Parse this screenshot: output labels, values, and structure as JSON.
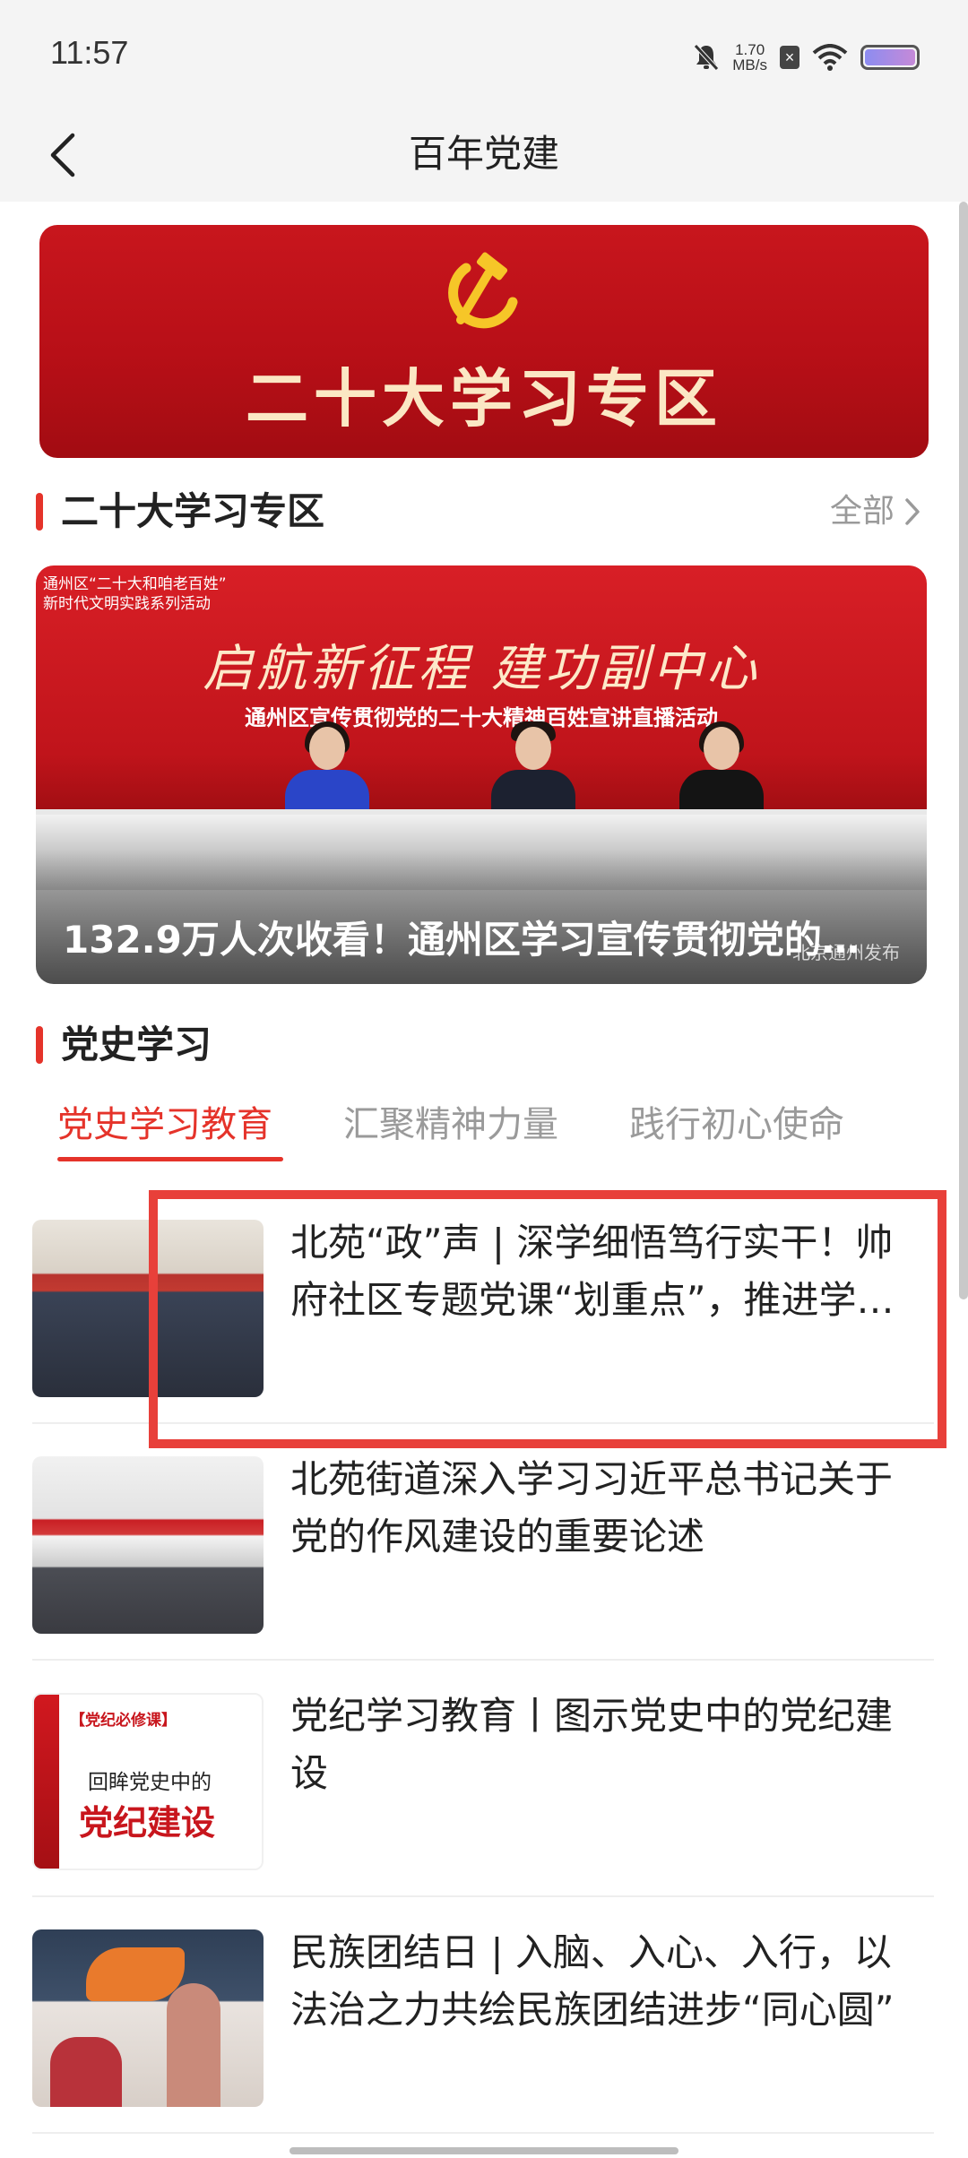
{
  "status_bar": {
    "time": "11:57",
    "net_speed_value": "1.70",
    "net_speed_unit": "MB/s",
    "icons": [
      "mute-icon",
      "close-badge-icon",
      "wifi-icon",
      "battery-icon"
    ]
  },
  "nav": {
    "title": "百年党建",
    "back_icon": "chevron-left-icon"
  },
  "banner": {
    "title": "二十大学习专区",
    "emblem_icon": "hammer-sickle-icon"
  },
  "section_study": {
    "title": "二十大学习专区",
    "more_label": "全部"
  },
  "feature": {
    "stage_top_text_1": "通州区“二十大和咱老百姓”",
    "stage_top_text_2": "新时代文明实践系列活动",
    "slogan": "启航新征程 建功副中心",
    "subtitle": "通州区宣传贯彻党的二十大精神百姓宣讲直播活动",
    "caption": "132.9万人次收看！通州区学习宣传贯彻党的…",
    "watermark": "北京通州发布"
  },
  "section_history": {
    "title": "党史学习"
  },
  "tabs": [
    {
      "label": "党史学习教育",
      "active": true
    },
    {
      "label": "汇聚精神力量",
      "active": false
    },
    {
      "label": "践行初心使命",
      "active": false
    }
  ],
  "news": [
    {
      "title": "北苑“政”声 | 深学细悟笃行实干！帅府社区专题党课“划重点”，推进学习教育走深走实"
    },
    {
      "title": "北苑街道深入学习习近平总书记关于党的作风建设的重要论述"
    },
    {
      "title": "党纪学习教育丨图示党史中的党纪建设",
      "thumb_tag": "【党纪必修课】",
      "thumb_line1": "回眸党史中的",
      "thumb_line2": "党纪建设"
    },
    {
      "title": "民族团结日 | 入脑、入心、入行，以法治之力共绘民族团结进步“同心圆”"
    }
  ],
  "colors": {
    "accent": "#e5332a",
    "banner_red": "#c8161d",
    "highlight": "#e8403a"
  }
}
